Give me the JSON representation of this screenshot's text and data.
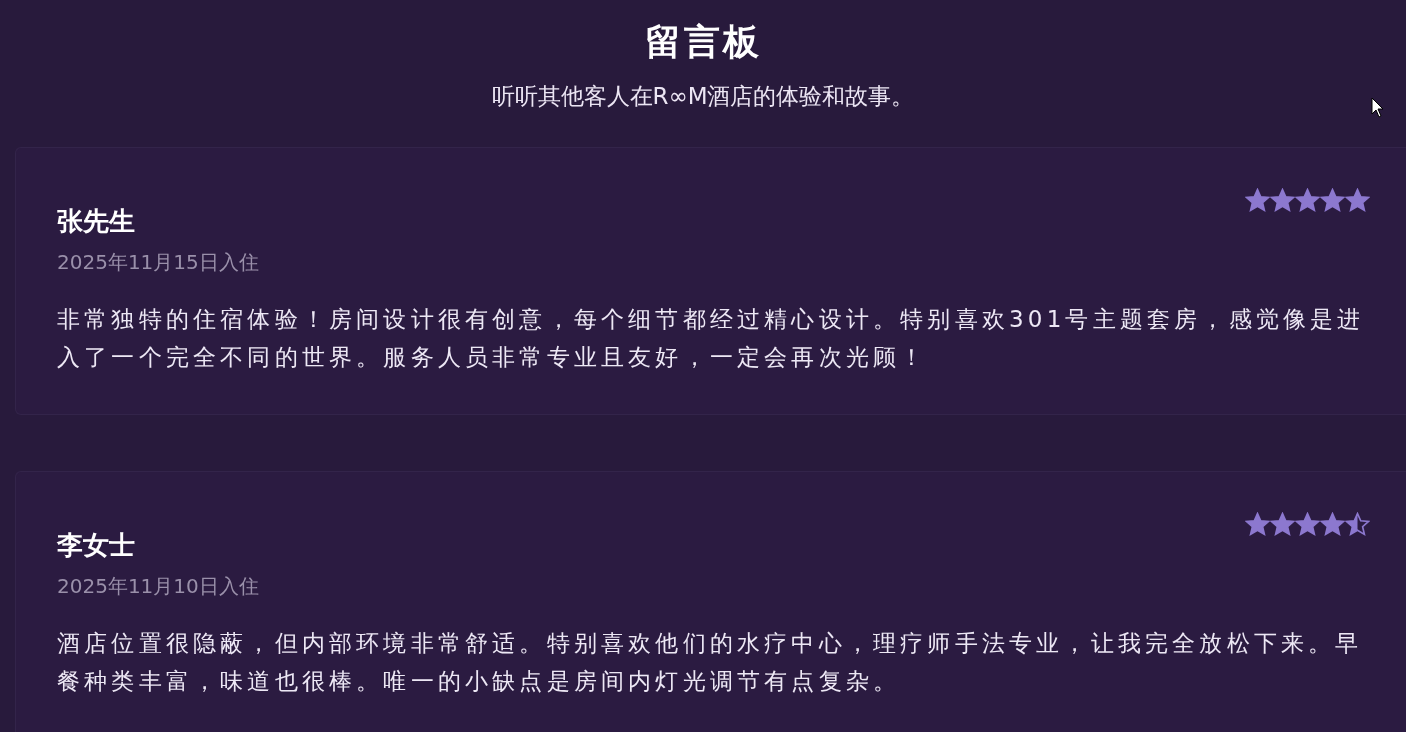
{
  "header": {
    "title": "留言板",
    "subtitle": "听听其他客人在R∞M酒店的体验和故事。"
  },
  "reviews": [
    {
      "name": "张先生",
      "date": "2025年11月15日入住",
      "stars": 5,
      "text": "非常独特的住宿体验！房间设计很有创意，每个细节都经过精心设计。特别喜欢301号主题套房，感觉像是进入了一个完全不同的世界。服务人员非常专业且友好，一定会再次光顾！"
    },
    {
      "name": "李女士",
      "date": "2025年11月10日入住",
      "stars": 4.5,
      "text": "酒店位置很隐蔽，但内部环境非常舒适。特别喜欢他们的水疗中心，理疗师手法专业，让我完全放松下来。早餐种类丰富，味道也很棒。唯一的小缺点是房间内灯光调节有点复杂。"
    }
  ]
}
